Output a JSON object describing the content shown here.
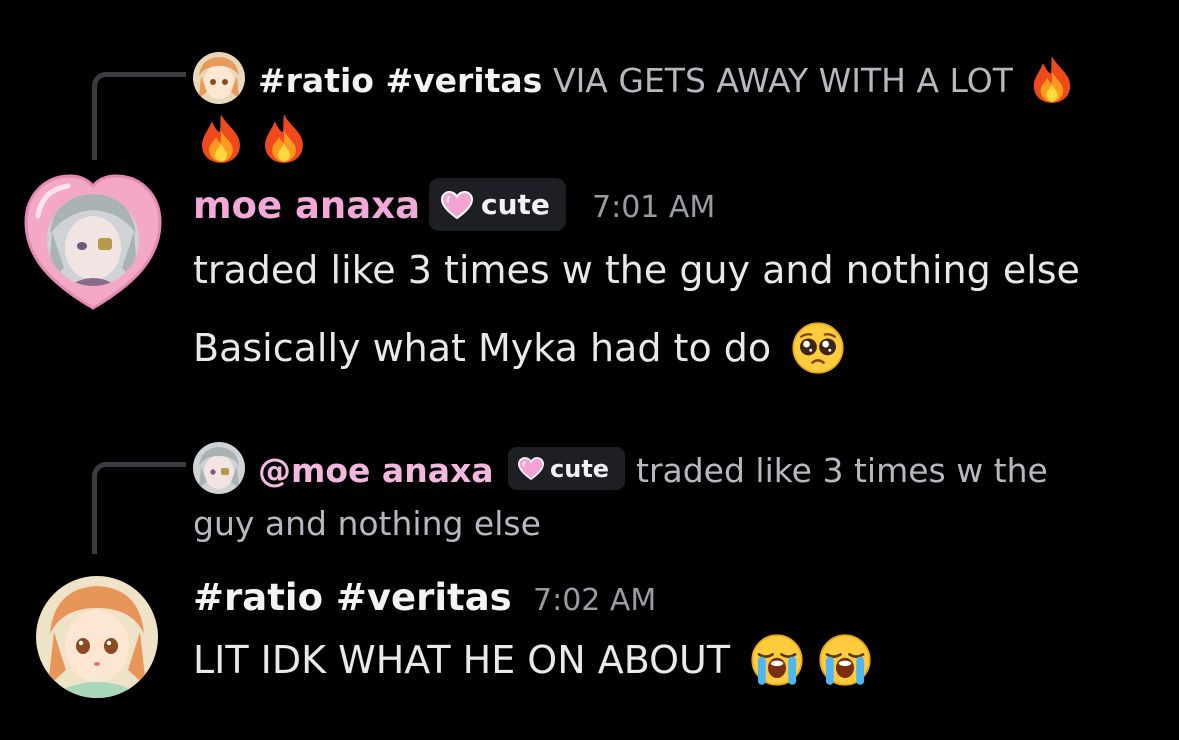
{
  "reply1": {
    "author": "#ratio #veritas",
    "snippet": "VIA GETS AWAY WITH A LOT",
    "snippet_emojis": [
      "fire",
      "fire",
      "fire"
    ]
  },
  "message1": {
    "author": "moe anaxa",
    "tag": "cute",
    "timestamp": "7:01 AM",
    "lines": [
      "traded like 3 times w the guy and nothing else",
      "Basically what Myka had to do"
    ],
    "line2_emoji": "pleading-face"
  },
  "reply2": {
    "mention": "@moe anaxa",
    "tag": "cute",
    "snippet_part1": "traded like 3 times w the",
    "snippet_part2": "guy and nothing else"
  },
  "message2": {
    "author": "#ratio #veritas",
    "timestamp": "7:02 AM",
    "text": "LIT IDK WHAT HE ON ABOUT",
    "emojis": [
      "loudly-crying-face",
      "loudly-crying-face"
    ]
  },
  "colors": {
    "background": "#000000",
    "author_pink": "#f2a8d8",
    "mention_pink": "#f4b7e0",
    "timestamp": "#9a9ca4",
    "snippet": "#b5b8bf"
  }
}
